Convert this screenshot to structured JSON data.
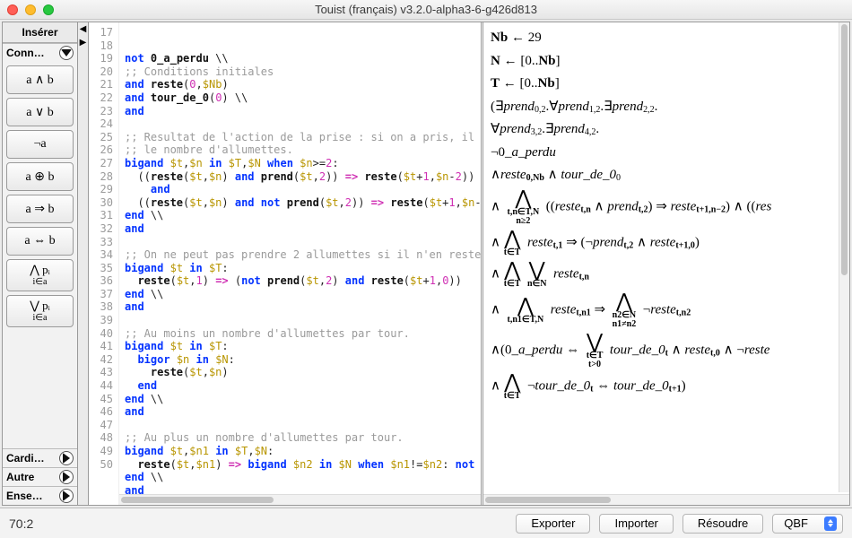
{
  "title": "Touist (français) v3.2.0-alpha3-6-g426d813",
  "sidebar": {
    "header": "Insérer",
    "group_conn": "Conn…",
    "buttons": [
      "a ∧ b",
      "a ∨ b",
      "¬a",
      "a ⊕ b",
      "a ⇒ b",
      "a ⇔ b"
    ],
    "bigand_top": "⋀ pᵢ",
    "bigand_bot": "i∈a",
    "bigor_top": "⋁ pᵢ",
    "bigor_bot": "i∈a",
    "rows": [
      "Cardi…",
      "Autre",
      "Ense…"
    ]
  },
  "editor": {
    "first_line": 17,
    "lines": [
      {
        "t": "code",
        "s": "<span class='kw'>not</span> <span class='fn'>0_a_perdu</span> \\\\"
      },
      {
        "t": "code",
        "s": "<span class='cm'>;; Conditions initiales</span>"
      },
      {
        "t": "code",
        "s": "<span class='kw'>and</span> <span class='fn'>reste</span>(<span class='num'>0</span>,<span class='var'>$Nb</span>)"
      },
      {
        "t": "code",
        "s": "<span class='kw'>and</span> <span class='fn'>tour_de_0</span>(<span class='num'>0</span>) \\\\"
      },
      {
        "t": "code",
        "s": "<span class='kw'>and</span>"
      },
      {
        "t": "code",
        "s": ""
      },
      {
        "t": "code",
        "s": "<span class='cm'>;; Resultat de l'action de la prise : si on a pris, il </span>"
      },
      {
        "t": "code",
        "s": "<span class='cm'>;; le nombre d'allumettes.</span>"
      },
      {
        "t": "code",
        "s": "<span class='kw'>bigand</span> <span class='var'>$t</span>,<span class='var'>$n</span> <span class='kw'>in</span> <span class='var'>$T</span>,<span class='var'>$N</span> <span class='kw'>when</span> <span class='var'>$n</span>&gt;=<span class='num'>2</span>:"
      },
      {
        "t": "code",
        "s": "  ((<span class='fn'>reste</span>(<span class='var'>$t</span>,<span class='var'>$n</span>) <span class='kw'>and</span> <span class='fn'>prend</span>(<span class='var'>$t</span>,<span class='num'>2</span>)) <span class='op'>=&gt;</span> <span class='fn'>reste</span>(<span class='var'>$t</span>+<span class='num'>1</span>,<span class='var'>$n</span>-<span class='num'>2</span>))"
      },
      {
        "t": "code",
        "s": "    <span class='kw'>and</span>"
      },
      {
        "t": "code",
        "s": "  ((<span class='fn'>reste</span>(<span class='var'>$t</span>,<span class='var'>$n</span>) <span class='kw'>and</span> <span class='kw'>not</span> <span class='fn'>prend</span>(<span class='var'>$t</span>,<span class='num'>2</span>)) <span class='op'>=&gt;</span> <span class='fn'>reste</span>(<span class='var'>$t</span>+<span class='num'>1</span>,<span class='var'>$n</span>-"
      },
      {
        "t": "code",
        "s": "<span class='kw'>end</span> \\\\"
      },
      {
        "t": "code",
        "s": "<span class='kw'>and</span>"
      },
      {
        "t": "code",
        "s": ""
      },
      {
        "t": "code",
        "s": "<span class='cm'>;; On ne peut pas prendre 2 allumettes si il n'en reste</span>"
      },
      {
        "t": "code",
        "s": "<span class='kw'>bigand</span> <span class='var'>$t</span> <span class='kw'>in</span> <span class='var'>$T</span>:"
      },
      {
        "t": "code",
        "s": "  <span class='fn'>reste</span>(<span class='var'>$t</span>,<span class='num'>1</span>) <span class='op'>=&gt;</span> (<span class='kw'>not</span> <span class='fn'>prend</span>(<span class='var'>$t</span>,<span class='num'>2</span>) <span class='kw'>and</span> <span class='fn'>reste</span>(<span class='var'>$t</span>+<span class='num'>1</span>,<span class='num'>0</span>))"
      },
      {
        "t": "code",
        "s": "<span class='kw'>end</span> \\\\"
      },
      {
        "t": "code",
        "s": "<span class='kw'>and</span>"
      },
      {
        "t": "code",
        "s": ""
      },
      {
        "t": "code",
        "s": "<span class='cm'>;; Au moins un nombre d'allumettes par tour.</span>"
      },
      {
        "t": "code",
        "s": "<span class='kw'>bigand</span> <span class='var'>$t</span> <span class='kw'>in</span> <span class='var'>$T</span>:"
      },
      {
        "t": "code",
        "s": "  <span class='kw'>bigor</span> <span class='var'>$n</span> <span class='kw'>in</span> <span class='var'>$N</span>:"
      },
      {
        "t": "code",
        "s": "    <span class='fn'>reste</span>(<span class='var'>$t</span>,<span class='var'>$n</span>)"
      },
      {
        "t": "code",
        "s": "  <span class='kw'>end</span>"
      },
      {
        "t": "code",
        "s": "<span class='kw'>end</span> \\\\"
      },
      {
        "t": "code",
        "s": "<span class='kw'>and</span>"
      },
      {
        "t": "code",
        "s": ""
      },
      {
        "t": "code",
        "s": "<span class='cm'>;; Au plus un nombre d'allumettes par tour.</span>"
      },
      {
        "t": "code",
        "s": "<span class='kw'>bigand</span> <span class='var'>$t</span>,<span class='var'>$n1</span> <span class='kw'>in</span> <span class='var'>$T</span>,<span class='var'>$N</span>:"
      },
      {
        "t": "code",
        "s": "  <span class='fn'>reste</span>(<span class='var'>$t</span>,<span class='var'>$n1</span>) <span class='op'>=&gt;</span> <span class='kw'>bigand</span> <span class='var'>$n2</span> <span class='kw'>in</span> <span class='var'>$N</span> <span class='kw'>when</span> <span class='var'>$n1</span>!=<span class='var'>$n2</span>: <span class='kw'>not</span> "
      },
      {
        "t": "code",
        "s": "<span class='kw'>end</span> \\\\"
      },
      {
        "t": "code",
        "s": "<span class='kw'>and</span>"
      }
    ]
  },
  "preview": {
    "l1": "Nb ← 29",
    "l2": "N ← [0..Nb]",
    "l3": "T ← [0..Nb]",
    "l4": "(∃prend₀,₂.∀prend₁,₂.∃prend₂,₂.",
    "l5": "∀prend₃,₂.∃prend₄,₂.",
    "l6": "¬0_a_perdu",
    "l7a": "∧reste",
    "l7b": "0,Nb",
    "l7c": " ∧ tour_de_0",
    "l7d": "0",
    "r8_sub1": "t,n∈T,N",
    "r8_sub2": "n≥2",
    "r8_body": "((restet,n ∧ prendt,2) ⇒ restet+1,n−2) ∧ ((res",
    "r9_sub": "t∈T",
    "r9_body": "restet,1 ⇒ (¬prendt,2 ∧ restet+1,0)",
    "r10_sub1": "t∈T",
    "r10_sub2": "n∈N",
    "r10_body": "restet,n",
    "r11_sub1": "t,n1∈T,N",
    "r11_body": "restet,n1 ⇒",
    "r11_sub2": "n2∈N",
    "r11_sub3": "n1≠n2",
    "r11_body2": "¬restet,n2",
    "r12_body": "∧(0_a_perdu ⇔",
    "r12_sub": "t∈T",
    "r12_sub2": "t>0",
    "r12_body2": "tour_de_0t ∧ restet,0 ∧ ¬reste",
    "r13_sub": "t∈T",
    "r13_body": "¬tour_de_0t ⇔ tour_de_0t+1)"
  },
  "status": "70:2",
  "buttons": {
    "export": "Exporter",
    "import": "Importer",
    "solve": "Résoudre",
    "solver": "QBF"
  }
}
